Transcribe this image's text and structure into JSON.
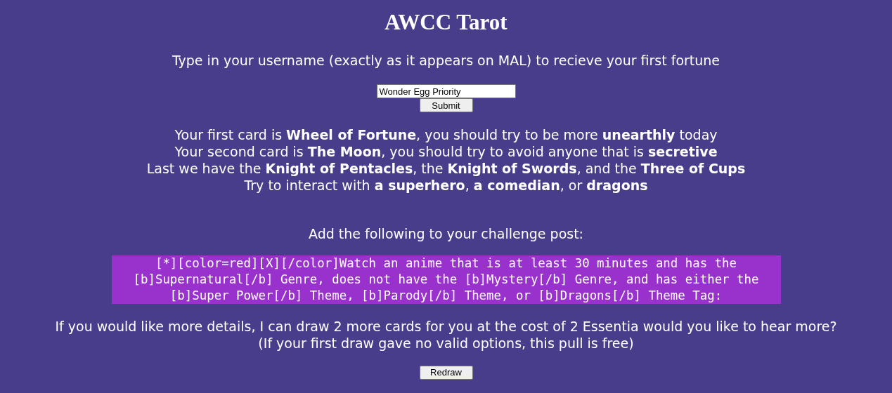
{
  "title": "AWCC Tarot",
  "prompt": "Type in your username (exactly as it appears on MAL) to recieve your first fortune",
  "username_field": {
    "value": "Wonder Egg Priority"
  },
  "submit_button": "Submit",
  "fortune_lines": [
    "Your first card is **Wheel of Fortune**, you should try to be more **unearthly** today",
    "Your second card is **The Moon**, you should try to avoid anyone that is **secretive**",
    "Last we have the **Knight of Pentacles**, the **Knight of Swords**, and the **Three of Cups**",
    "Try to interact with **a superhero**, **a comedian**, or **dragons**"
  ],
  "challenge_heading": "Add the following to your challenge post:",
  "challenge_code": "[*][color=red][X][/color]Watch an anime that is at least 30 minutes and has the [b]Supernatural[/b] Genre, does not have the [b]Mystery[/b] Genre, and has either the [b]Super Power[/b] Theme, [b]Parody[/b] Theme, or [b]Dragons[/b] Theme Tag:",
  "details_lines": [
    "If you would like more details, I can draw 2 more cards for you at the cost of 2 Essentia would you like to hear more?",
    "(If your first draw gave no valid options, this pull is free)"
  ],
  "redraw_button": "Redraw"
}
